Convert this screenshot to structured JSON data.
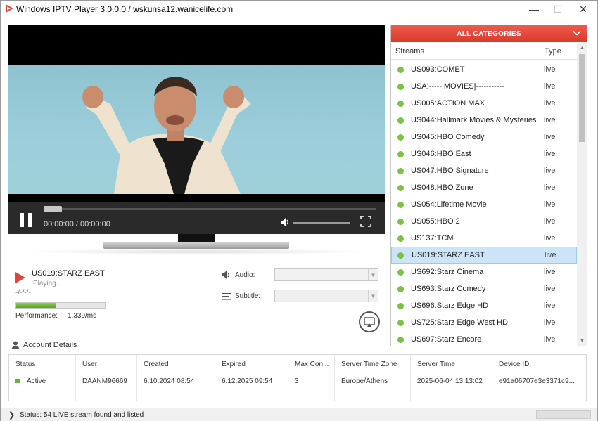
{
  "window": {
    "title": "Windows IPTV Player 3.0.0.0 / wskunsa12.wanicelife.com",
    "minimize": "—",
    "maximize": "☐",
    "close": "✕"
  },
  "player": {
    "time": "00:00:00 / 00:00:00",
    "seek_fraction": 0,
    "volume_fraction": 0
  },
  "now_playing": {
    "channel": "US019:STARZ EAST",
    "status": "Playing...",
    "date_placeholder": "-/-/-/-",
    "performance_label": "Performance:",
    "performance_value": "1.339/ms",
    "performance_fraction": 0.45
  },
  "tracks": {
    "audio_label": "Audio:",
    "audio_value": "",
    "subtitle_label": "Subtitle:",
    "subtitle_value": ""
  },
  "account": {
    "title": "Account Details",
    "headers": [
      "Status",
      "User",
      "Created",
      "Expired",
      "Max Con...",
      "Server Time Zone",
      "Server Time",
      "Device ID"
    ],
    "values": [
      "Active",
      "DAANM96669",
      "6.10.2024 08:54",
      "6.12.2025 09:54",
      "3",
      "Europe/Athens",
      "2025-06-04 13:13:02",
      "e91a06707e3e3371c9..."
    ]
  },
  "status_bar": {
    "text": "Status: 54 LIVE stream found and listed"
  },
  "categories": {
    "header": "ALL CATEGORIES",
    "col_streams": "Streams",
    "col_type": "Type",
    "selected_index": 11,
    "streams": [
      {
        "name": "US093:COMET",
        "type": "live"
      },
      {
        "name": "USA:-----|MOVIES|-----------",
        "type": "live"
      },
      {
        "name": "US005:ACTION MAX",
        "type": "live"
      },
      {
        "name": "US044:Hallmark Movies & Mysteries",
        "type": "live"
      },
      {
        "name": "US045:HBO Comedy",
        "type": "live"
      },
      {
        "name": "US046:HBO East",
        "type": "live"
      },
      {
        "name": "US047:HBO Signature",
        "type": "live"
      },
      {
        "name": "US048:HBO Zone",
        "type": "live"
      },
      {
        "name": "US054:Lifetime Movie",
        "type": "live"
      },
      {
        "name": "US055:HBO 2",
        "type": "live"
      },
      {
        "name": "US137:TCM",
        "type": "live"
      },
      {
        "name": "US019:STARZ EAST",
        "type": "live"
      },
      {
        "name": "US692:Starz Cinema",
        "type": "live"
      },
      {
        "name": "US693:Starz Comedy",
        "type": "live"
      },
      {
        "name": "US696:Starz Edge HD",
        "type": "live"
      },
      {
        "name": "US725:Starz Edge West HD",
        "type": "live"
      },
      {
        "name": "US697:Starz Encore",
        "type": "live"
      }
    ]
  },
  "colors": {
    "accent": "#e2463a",
    "live_dot": "#7cc242",
    "selection": "#cce4f7"
  }
}
